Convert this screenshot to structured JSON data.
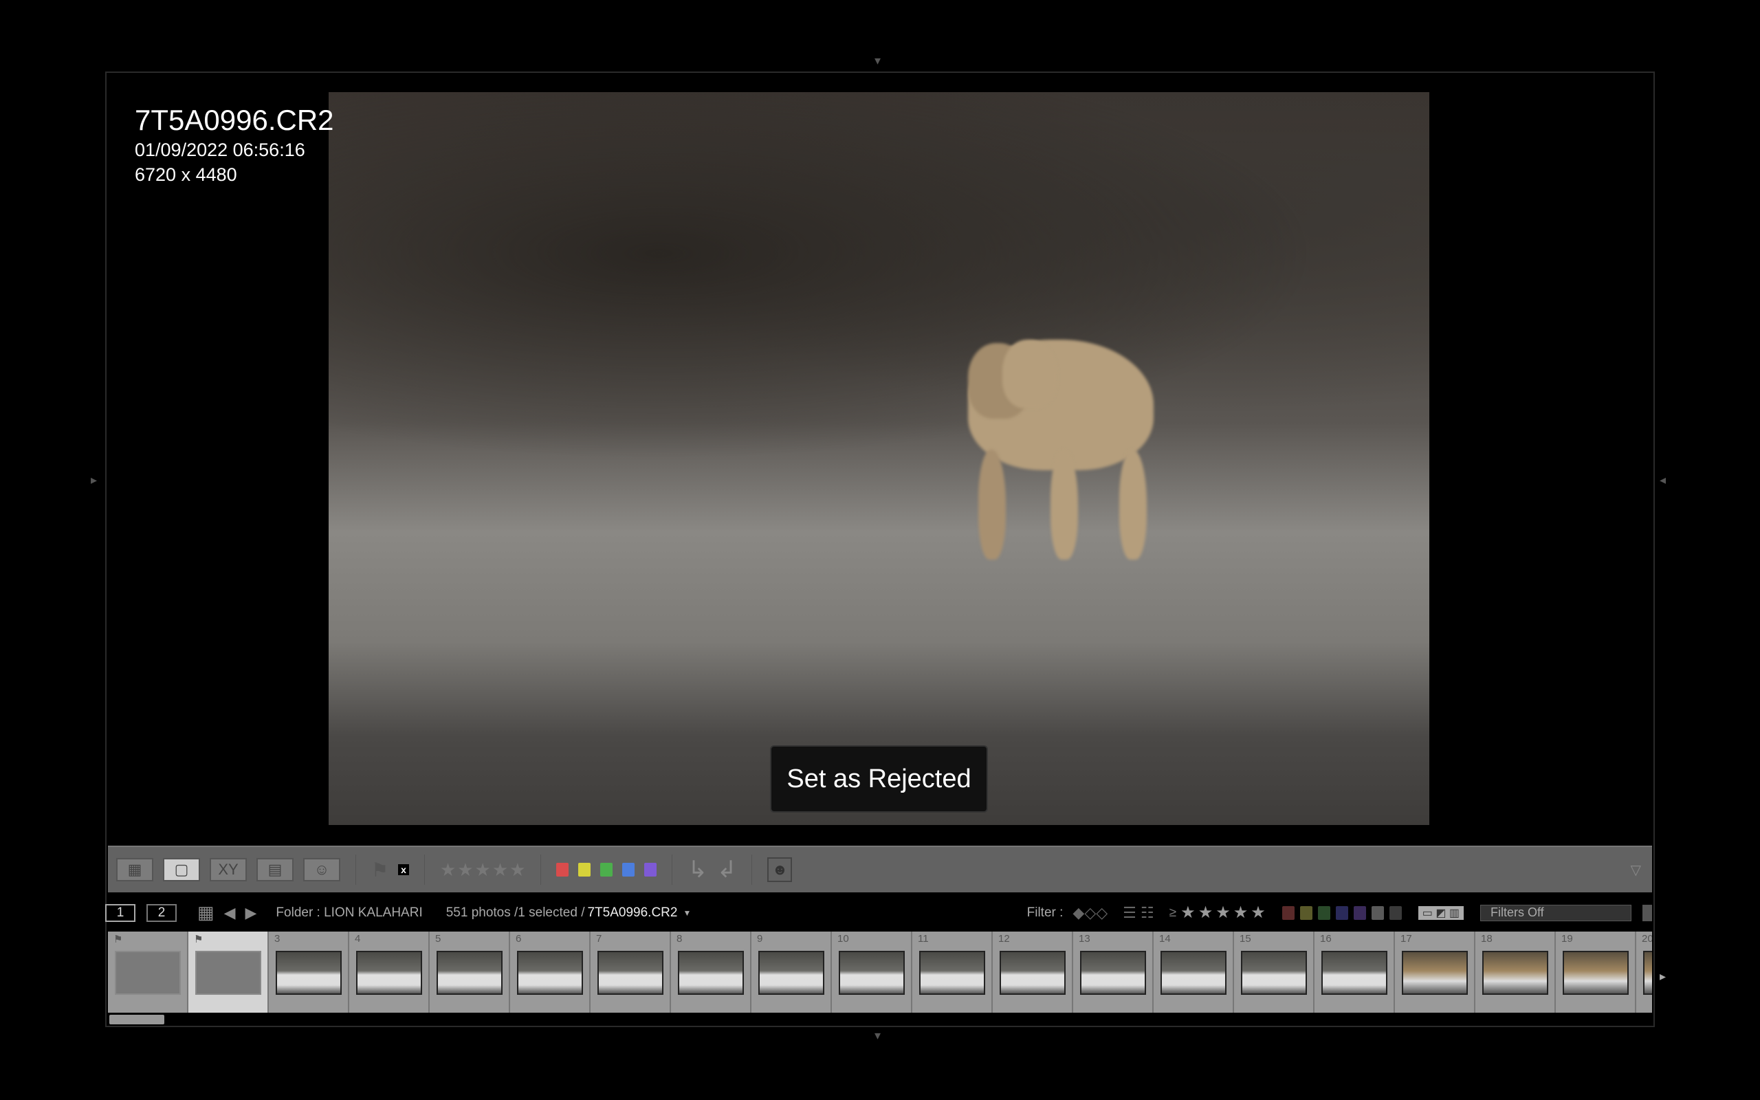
{
  "photo": {
    "filename": "7T5A0996.CR2",
    "datetime": "01/09/2022 06:56:16",
    "dimensions": "6720 x 4480"
  },
  "toast": "Set as Rejected",
  "toolbar": {
    "views": [
      "grid-view",
      "loupe-view",
      "compare-view",
      "survey-view",
      "people-view"
    ],
    "compare_label": "XY",
    "flag_reject": "x",
    "stars": [
      "★",
      "★",
      "★",
      "★",
      "★"
    ],
    "labels": [
      "#d94c4c",
      "#d6d23a",
      "#4caf4c",
      "#4c7ede",
      "#7e5ad6"
    ]
  },
  "subbar": {
    "page1": "1",
    "page2": "2",
    "folder": "Folder : LION KALAHARI",
    "count": "551 photos /1 selected /",
    "selected": "7T5A0996.CR2",
    "filter_label": "Filter :",
    "gte": "≥",
    "filter_stars": [
      "★",
      "★",
      "★",
      "★",
      "★"
    ],
    "filter_colors": [
      "#5a2a2a",
      "#5a5a2a",
      "#2a4a2a",
      "#2a2a5a",
      "#3a2a5a",
      "#5a5a5a",
      "#3a3a3a"
    ],
    "filters_value": "Filters Off"
  },
  "filmstrip": {
    "cells": [
      "",
      "",
      "3",
      "4",
      "5",
      "6",
      "7",
      "8",
      "9",
      "10",
      "11",
      "12",
      "13",
      "14",
      "15",
      "16",
      "17",
      "18",
      "19",
      "20"
    ],
    "selected_index": 1,
    "flagged": [
      0,
      1
    ]
  }
}
